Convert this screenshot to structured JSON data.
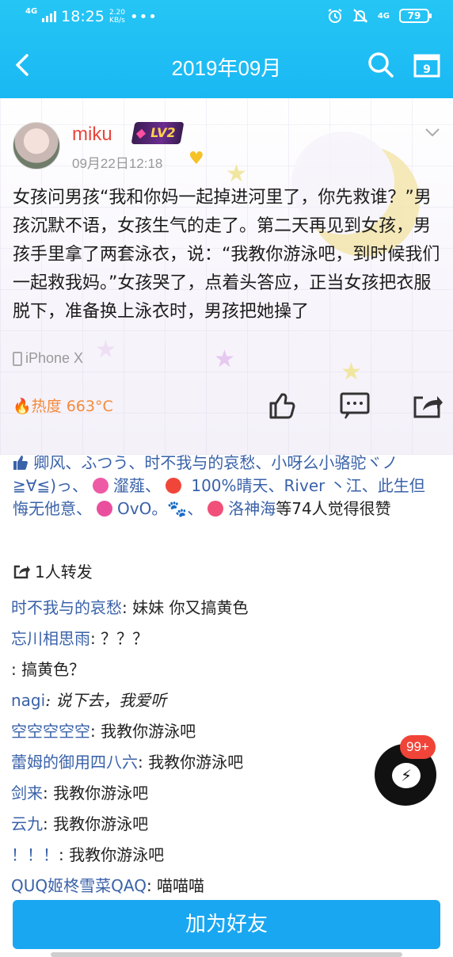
{
  "status_bar": {
    "network": "4G",
    "time": "18:25",
    "speed": "2.20",
    "speed_unit": "KB/s",
    "dots": "•••",
    "network_right": "4G",
    "battery": "79"
  },
  "nav": {
    "title": "2019年09月",
    "calendar_day": "9"
  },
  "post": {
    "username": "miku",
    "level_badge": "LV2",
    "time": "09月22日12:18",
    "text": "女孩问男孩“我和你妈一起掉进河里了，你先救谁？”男孩沉默不语，女孩生气的走了。第二天再见到女孩，男孩手里拿了两套泳衣，说：“我教你游泳吧，到时候我们一起救我妈。”女孩哭了，点着头答应，正当女孩把衣服脱下，准备换上泳衣时，男孩把她操了",
    "device": "iPhone X",
    "hot_label": "🔥热度 663°C"
  },
  "likes": {
    "part1": "卿风、ふつう、时不我与的哀愁、小呀么小骆驼ヾノ≧∀≦)っ、",
    "part2": "瀣薤、",
    "part3": " 100%晴天、River 丶江、此生但悔无他意、",
    "part4": "OvO。",
    "part5": "、",
    "part6": "洛神海",
    "suffix": "等74人觉得很赞"
  },
  "forward": {
    "label": "1人转发"
  },
  "comments": [
    {
      "who": "时不我与的哀愁",
      "text": ": 妹妹 你又搞黄色"
    },
    {
      "who": "忘川相思雨",
      "text": ": ？？？"
    },
    {
      "who": "",
      "text": ": 搞黄色？"
    },
    {
      "who": "nagi",
      "text": ": 说下去，我爱听"
    },
    {
      "who": "空空空空空",
      "text": ": 我教你游泳吧"
    },
    {
      "who": "蕾姆的御用四八六",
      "text": ": 我教你游泳吧"
    },
    {
      "who": "剑来",
      "text": ": 我教你游泳吧"
    },
    {
      "who": "云九",
      "text": ": 我教你游泳吧"
    },
    {
      "who": "！！！",
      "text": ": 我教你游泳吧"
    },
    {
      "who": "QUQ姬柊雪菜QAQ",
      "text": ": 喵喵喵"
    }
  ],
  "float": {
    "badge": "99+"
  },
  "bottom": {
    "add_friend": "加为好友"
  },
  "colors": {
    "header": "#1ab8f3",
    "username": "#e8453c",
    "link": "#3a62a9",
    "hot": "#f58a3b",
    "button": "#1aa7f1"
  }
}
